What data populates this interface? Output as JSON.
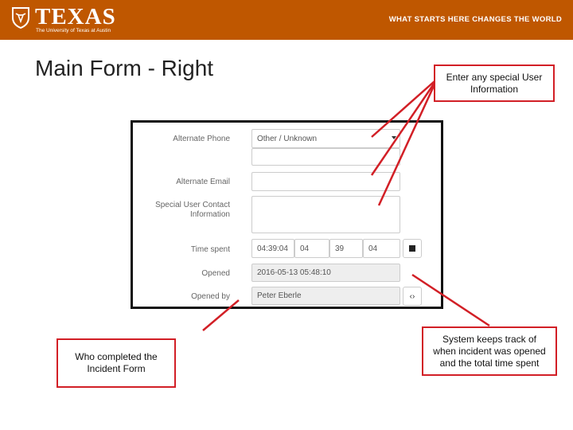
{
  "header": {
    "logo_word": "TEXAS",
    "logo_sub": "The University of Texas at Austin",
    "tagline": "WHAT STARTS HERE CHANGES THE WORLD"
  },
  "slide": {
    "title": "Main Form - Right"
  },
  "form": {
    "alternate_phone_label": "Alternate Phone",
    "alternate_phone_value": "Other / Unknown",
    "alternate_email_label": "Alternate Email",
    "special_contact_label": "Special User Contact\nInformation",
    "time_spent_label": "Time spent",
    "time_spent_total": "04:39:04",
    "time_spent_hours": "04",
    "time_spent_minutes": "39",
    "time_spent_seconds": "04",
    "opened_label": "Opened",
    "opened_value": "2016-05-13 05:48:10",
    "opened_by_label": "Opened by",
    "opened_by_value": "Peter Eberle"
  },
  "callouts": {
    "special": "Enter any special User\nInformation",
    "who": "Who completed the\nIncident Form",
    "tracking": "System keeps track of\nwhen incident was opened\nand the total time spent"
  },
  "colors": {
    "banner": "#bf5700",
    "callout_border": "#d21f26"
  }
}
